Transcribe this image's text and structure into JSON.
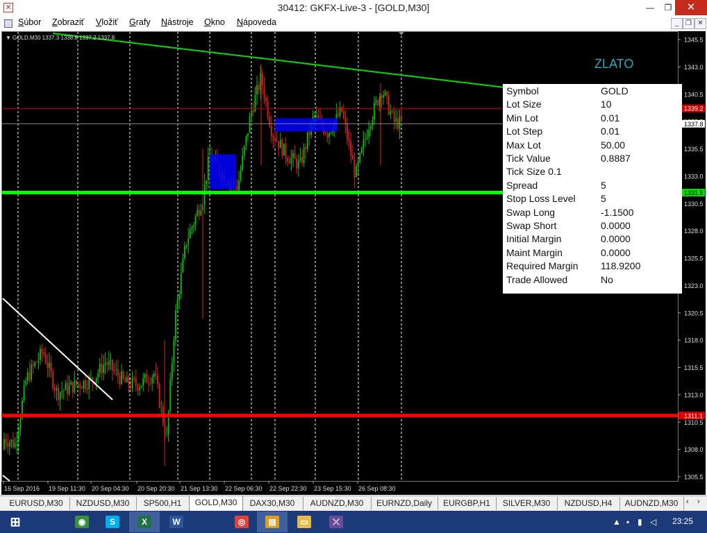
{
  "window": {
    "title": "30412: GKFX-Live-3 - [GOLD,M30]"
  },
  "menu": [
    {
      "label": "Súbor",
      "key": "S",
      "rest": "úbor"
    },
    {
      "label": "Zobraziť",
      "key": "Z",
      "rest": "obraziť"
    },
    {
      "label": "Vložiť",
      "key": "V",
      "rest": "ložiť"
    },
    {
      "label": "Grafy",
      "key": "G",
      "rest": "rafy"
    },
    {
      "label": "Nástroje",
      "key": "N",
      "rest": "ástroje"
    },
    {
      "label": "Okno",
      "key": "O",
      "rest": "kno"
    },
    {
      "label": "Nápoveda",
      "key": "N",
      "rest": "ápoveda"
    }
  ],
  "chart": {
    "header": "GOLD,M30  1337.3 1338.8 1337.2 1337.8",
    "watermark": "ZLATO",
    "price_labels": [
      "1345.5",
      "1343.0",
      "1340.5",
      "1338.0",
      "1335.5",
      "1333.0",
      "1330.5",
      "1328.0",
      "1325.5",
      "1323.0",
      "1320.5",
      "1318.0",
      "1315.5",
      "1313.0",
      "1310.5",
      "1308.0",
      "1305.5"
    ],
    "current_price": "1337.8",
    "tags": {
      "red_top": "1339.2",
      "green": "1331.5",
      "red_bottom": "1311.1"
    },
    "time_labels": [
      "16 Sep 2016",
      "19 Sep 11:30",
      "20 Sep 04:30",
      "20 Sep 20:30",
      "21 Sep 13:30",
      "22 Sep 06:30",
      "22 Sep 22:30",
      "23 Sep 15:30",
      "26 Sep 08:30"
    ],
    "colors": {
      "background": "#000000",
      "bull": "#00c800",
      "bear": "#e02020",
      "grid": "#ffffff",
      "trend": "#00e000",
      "support": "#00ff00",
      "resistance": "#ff0000",
      "box": "#0000ff"
    }
  },
  "info": [
    {
      "label": "Symbol",
      "value": "GOLD"
    },
    {
      "label": "Lot Size",
      "value": "10"
    },
    {
      "label": "Min Lot",
      "value": "0.01"
    },
    {
      "label": "Lot Step",
      "value": "0.01"
    },
    {
      "label": "Max Lot",
      "value": "50.00"
    },
    {
      "label": "Tick Value",
      "value": "0.8887"
    },
    {
      "label": "Tick Size 0.1",
      "value": ""
    },
    {
      "label": "Spread",
      "value": "5"
    },
    {
      "label": "Stop Loss Level",
      "value": "5"
    },
    {
      "label": "Swap Long",
      "value": "-1.1500"
    },
    {
      "label": "Swap Short",
      "value": "0.0000"
    },
    {
      "label": "Initial Margin",
      "value": "0.0000"
    },
    {
      "label": "Maint Margin",
      "value": "0.0000"
    },
    {
      "label": "Required Margin",
      "value": "118.9200"
    },
    {
      "label": "Trade Allowed",
      "value": "No"
    }
  ],
  "tabs": [
    "EURUSD,M30",
    "NZDUSD,M30",
    "SP500,H1",
    "GOLD,M30",
    "DAX30,M30",
    "AUDNZD,M30",
    "EURNZD,Daily",
    "EURGBP,H1",
    "SILVER,M30",
    "NZDUSD,H4",
    "AUDNZD,M30"
  ],
  "active_tab": 3,
  "taskbar": {
    "apps": [
      {
        "name": "windows-start",
        "glyph": "⊞",
        "color": "#1d3a78"
      },
      {
        "name": "app-sphere",
        "glyph": "◉",
        "color": "#3a8f3a"
      },
      {
        "name": "skype",
        "glyph": "S",
        "color": "#00aff0"
      },
      {
        "name": "excel",
        "glyph": "X",
        "color": "#1f7244"
      },
      {
        "name": "word",
        "glyph": "W",
        "color": "#2b579a"
      },
      {
        "name": "chrome",
        "glyph": "◎",
        "color": "#db4437"
      },
      {
        "name": "metatrader",
        "glyph": "▤",
        "color": "#d9a020"
      },
      {
        "name": "file-explorer",
        "glyph": "▭",
        "color": "#e8b84a"
      },
      {
        "name": "app-purple",
        "glyph": "⤫",
        "color": "#6a4b9c"
      }
    ],
    "clock": "23:25"
  }
}
